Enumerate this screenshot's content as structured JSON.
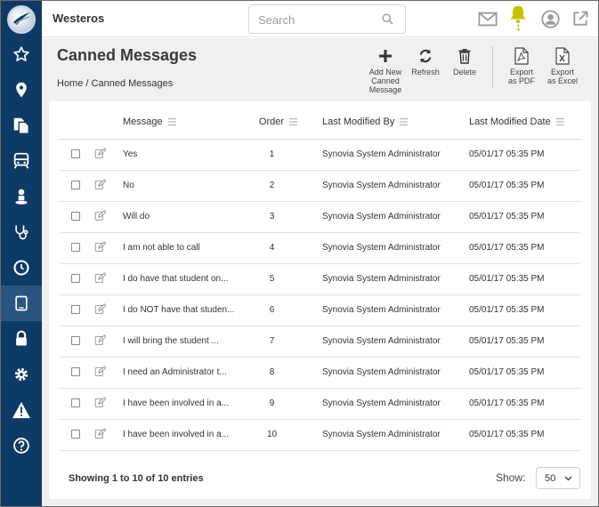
{
  "app": {
    "brand": "Westeros"
  },
  "search": {
    "placeholder": "Search"
  },
  "notifications": {
    "count": "1"
  },
  "page": {
    "title": "Canned Messages",
    "breadcrumb_home": "Home",
    "breadcrumb_sep": "/",
    "breadcrumb_current": "Canned Messages"
  },
  "toolbar": {
    "add_label_1": "Add New",
    "add_label_2": "Canned",
    "add_label_3": "Message",
    "refresh_label": "Refresh",
    "delete_label": "Delete",
    "pdf_label_1": "Export",
    "pdf_label_2": "as PDF",
    "excel_label_1": "Export",
    "excel_label_2": "as Excel"
  },
  "table": {
    "headers": {
      "message": "Message",
      "order": "Order",
      "modified_by": "Last Modified By",
      "modified_date": "Last Modified Date"
    },
    "rows": [
      {
        "message": "Yes",
        "order": "1",
        "modified_by": "Synovia System Administrator",
        "modified_date": "05/01/17 05:35 PM"
      },
      {
        "message": "No",
        "order": "2",
        "modified_by": "Synovia System Administrator",
        "modified_date": "05/01/17 05:35 PM"
      },
      {
        "message": "Will do",
        "order": "3",
        "modified_by": "Synovia System Administrator",
        "modified_date": "05/01/17 05:35 PM"
      },
      {
        "message": "I am not able to call",
        "order": "4",
        "modified_by": "Synovia System Administrator",
        "modified_date": "05/01/17 05:35 PM"
      },
      {
        "message": "I do have that student on...",
        "order": "5",
        "modified_by": "Synovia System Administrator",
        "modified_date": "05/01/17 05:35 PM"
      },
      {
        "message": "I do NOT have that studen...",
        "order": "6",
        "modified_by": "Synovia System Administrator",
        "modified_date": "05/01/17 05:35 PM"
      },
      {
        "message": "I will bring the student ...",
        "order": "7",
        "modified_by": "Synovia System Administrator",
        "modified_date": "05/01/17 05:35 PM"
      },
      {
        "message": "I need an Administrator t...",
        "order": "8",
        "modified_by": "Synovia System Administrator",
        "modified_date": "05/01/17 05:35 PM"
      },
      {
        "message": "I have been involved in a...",
        "order": "9",
        "modified_by": "Synovia System Administrator",
        "modified_date": "05/01/17 05:35 PM"
      },
      {
        "message": "I have been involved in a...",
        "order": "10",
        "modified_by": "Synovia System Administrator",
        "modified_date": "05/01/17 05:35 PM"
      }
    ]
  },
  "footer": {
    "info": "Showing 1 to 10 of 10 entries",
    "show_label": "Show:",
    "page_size": "50"
  },
  "colors": {
    "sidebar": "#0e3a66",
    "sidebar_active": "#2a5580",
    "bell": "#c8c100"
  },
  "icons": {
    "sidebar": [
      "star-icon",
      "location-pin-icon",
      "documents-icon",
      "bus-icon",
      "person-icon",
      "stethoscope-icon",
      "clock-icon",
      "tablet-icon",
      "lock-icon",
      "gear-icon",
      "warning-icon",
      "help-icon"
    ],
    "top": [
      "envelope-icon",
      "bell-icon",
      "user-avatar-icon",
      "external-link-icon"
    ]
  }
}
